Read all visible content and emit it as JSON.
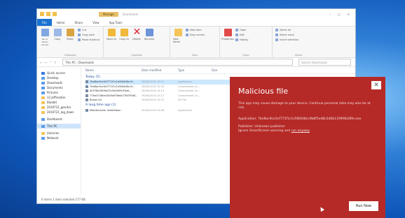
{
  "window": {
    "title": "Downloads",
    "context_tab": "Manage",
    "controls": [
      "–",
      "□",
      "✕"
    ]
  },
  "ribbon": {
    "tabs": [
      "File",
      "Home",
      "Share",
      "View",
      "App Tools"
    ],
    "clipboard": {
      "label": "Clipboard",
      "pin": "Pin to Quick access",
      "copy": "Copy",
      "paste": "Paste",
      "cut": "Cut",
      "copy_path": "Copy path",
      "paste_shortcut": "Paste shortcut"
    },
    "organize": {
      "label": "Organize",
      "move_to": "Move to",
      "copy_to": "Copy to",
      "delete": "Delete",
      "rename": "Rename"
    },
    "new": {
      "label": "New",
      "new_folder": "New folder",
      "new_item": "New item",
      "easy_access": "Easy access"
    },
    "open": {
      "label": "Open",
      "properties": "Properties",
      "open_btn": "Open",
      "edit": "Edit",
      "history": "History"
    },
    "select": {
      "label": "Select",
      "select_all": "Select all",
      "select_none": "Select none",
      "invert": "Invert selection"
    }
  },
  "address": {
    "nav": "← → ⌃ ↑",
    "path": "This PC › Downloads",
    "search_placeholder": "Search Downloads"
  },
  "navpane": {
    "items": [
      {
        "label": "Quick access",
        "kind": "star"
      },
      {
        "label": "Desktop",
        "kind": "blue"
      },
      {
        "label": "Downloads",
        "kind": "blue"
      },
      {
        "label": "Documents",
        "kind": "blue"
      },
      {
        "label": "Pictures",
        "kind": "blue"
      },
      {
        "label": "12 Jeffrosdier",
        "kind": "folder"
      },
      {
        "label": "Bluebit",
        "kind": "folder"
      },
      {
        "label": "2016721_gendra",
        "kind": "folder"
      },
      {
        "label": "2016721_log_down",
        "kind": "folder"
      },
      {
        "label": "Dashboard",
        "kind": "blue"
      },
      {
        "label": "This PC",
        "kind": "blue",
        "selected": true
      },
      {
        "label": "Libraries",
        "kind": "folder"
      },
      {
        "label": "Network",
        "kind": "blue"
      }
    ]
  },
  "columns": {
    "name": "Name",
    "date": "Date modified",
    "type": "Type",
    "size": "Size"
  },
  "groups": [
    {
      "label": "Today (5)",
      "rows": [
        {
          "name": "7be8ac9ce3cf771f1c1e5fb0d8cc9...",
          "date": "26/06/2018 10:21",
          "type": "Application",
          "size": "",
          "selected": true
        },
        {
          "name": "7be8ac9ce3cf771f1c1e5fb0d8cc9...",
          "date": "26/06/2018 10:20",
          "type": "Compressed (zi...",
          "size": ""
        },
        {
          "name": "d0578b390ffa25c5b4f0ffc92b8...",
          "date": "26/06/2018 10:19",
          "type": "Compressed (zi...",
          "size": ""
        },
        {
          "name": "77be5726be3426d5f3b6a778f7f5d0...",
          "date": "26/06/2018 10:17",
          "type": "Compressed (zi...",
          "size": ""
        },
        {
          "name": "Brown.dll",
          "date": "26/06/2018 10:15",
          "type": "Dll File",
          "size": ""
        }
      ]
    },
    {
      "label": "A long time ago (1)",
      "rows": [
        {
          "name": "MobileLocker Installation",
          "date": "26/06/2018 10:08",
          "type": "Application",
          "size": ""
        }
      ]
    }
  ],
  "status": "6 items   1 item selected  177 KB",
  "dialog": {
    "title": "Malicious file",
    "warning": "This app may cause damage to your device. Continue personal data may also be at risk.",
    "app_name_label": "Application:",
    "app_name": "7be8ac9ce3cf771f1c1e5fb0d8cc9b8f5e48c2d6b1199f4b28fe.exe",
    "publisher_label": "Publisher:",
    "publisher": "Unknown publisher",
    "ignore_text": "Ignore SmartScreen warning and",
    "link": "run anyway",
    "run_button": "Run Now"
  },
  "colors": {
    "dialog_bg": "#b52a27",
    "accent": "#1a73d1",
    "desktop": "#0e55b8"
  }
}
